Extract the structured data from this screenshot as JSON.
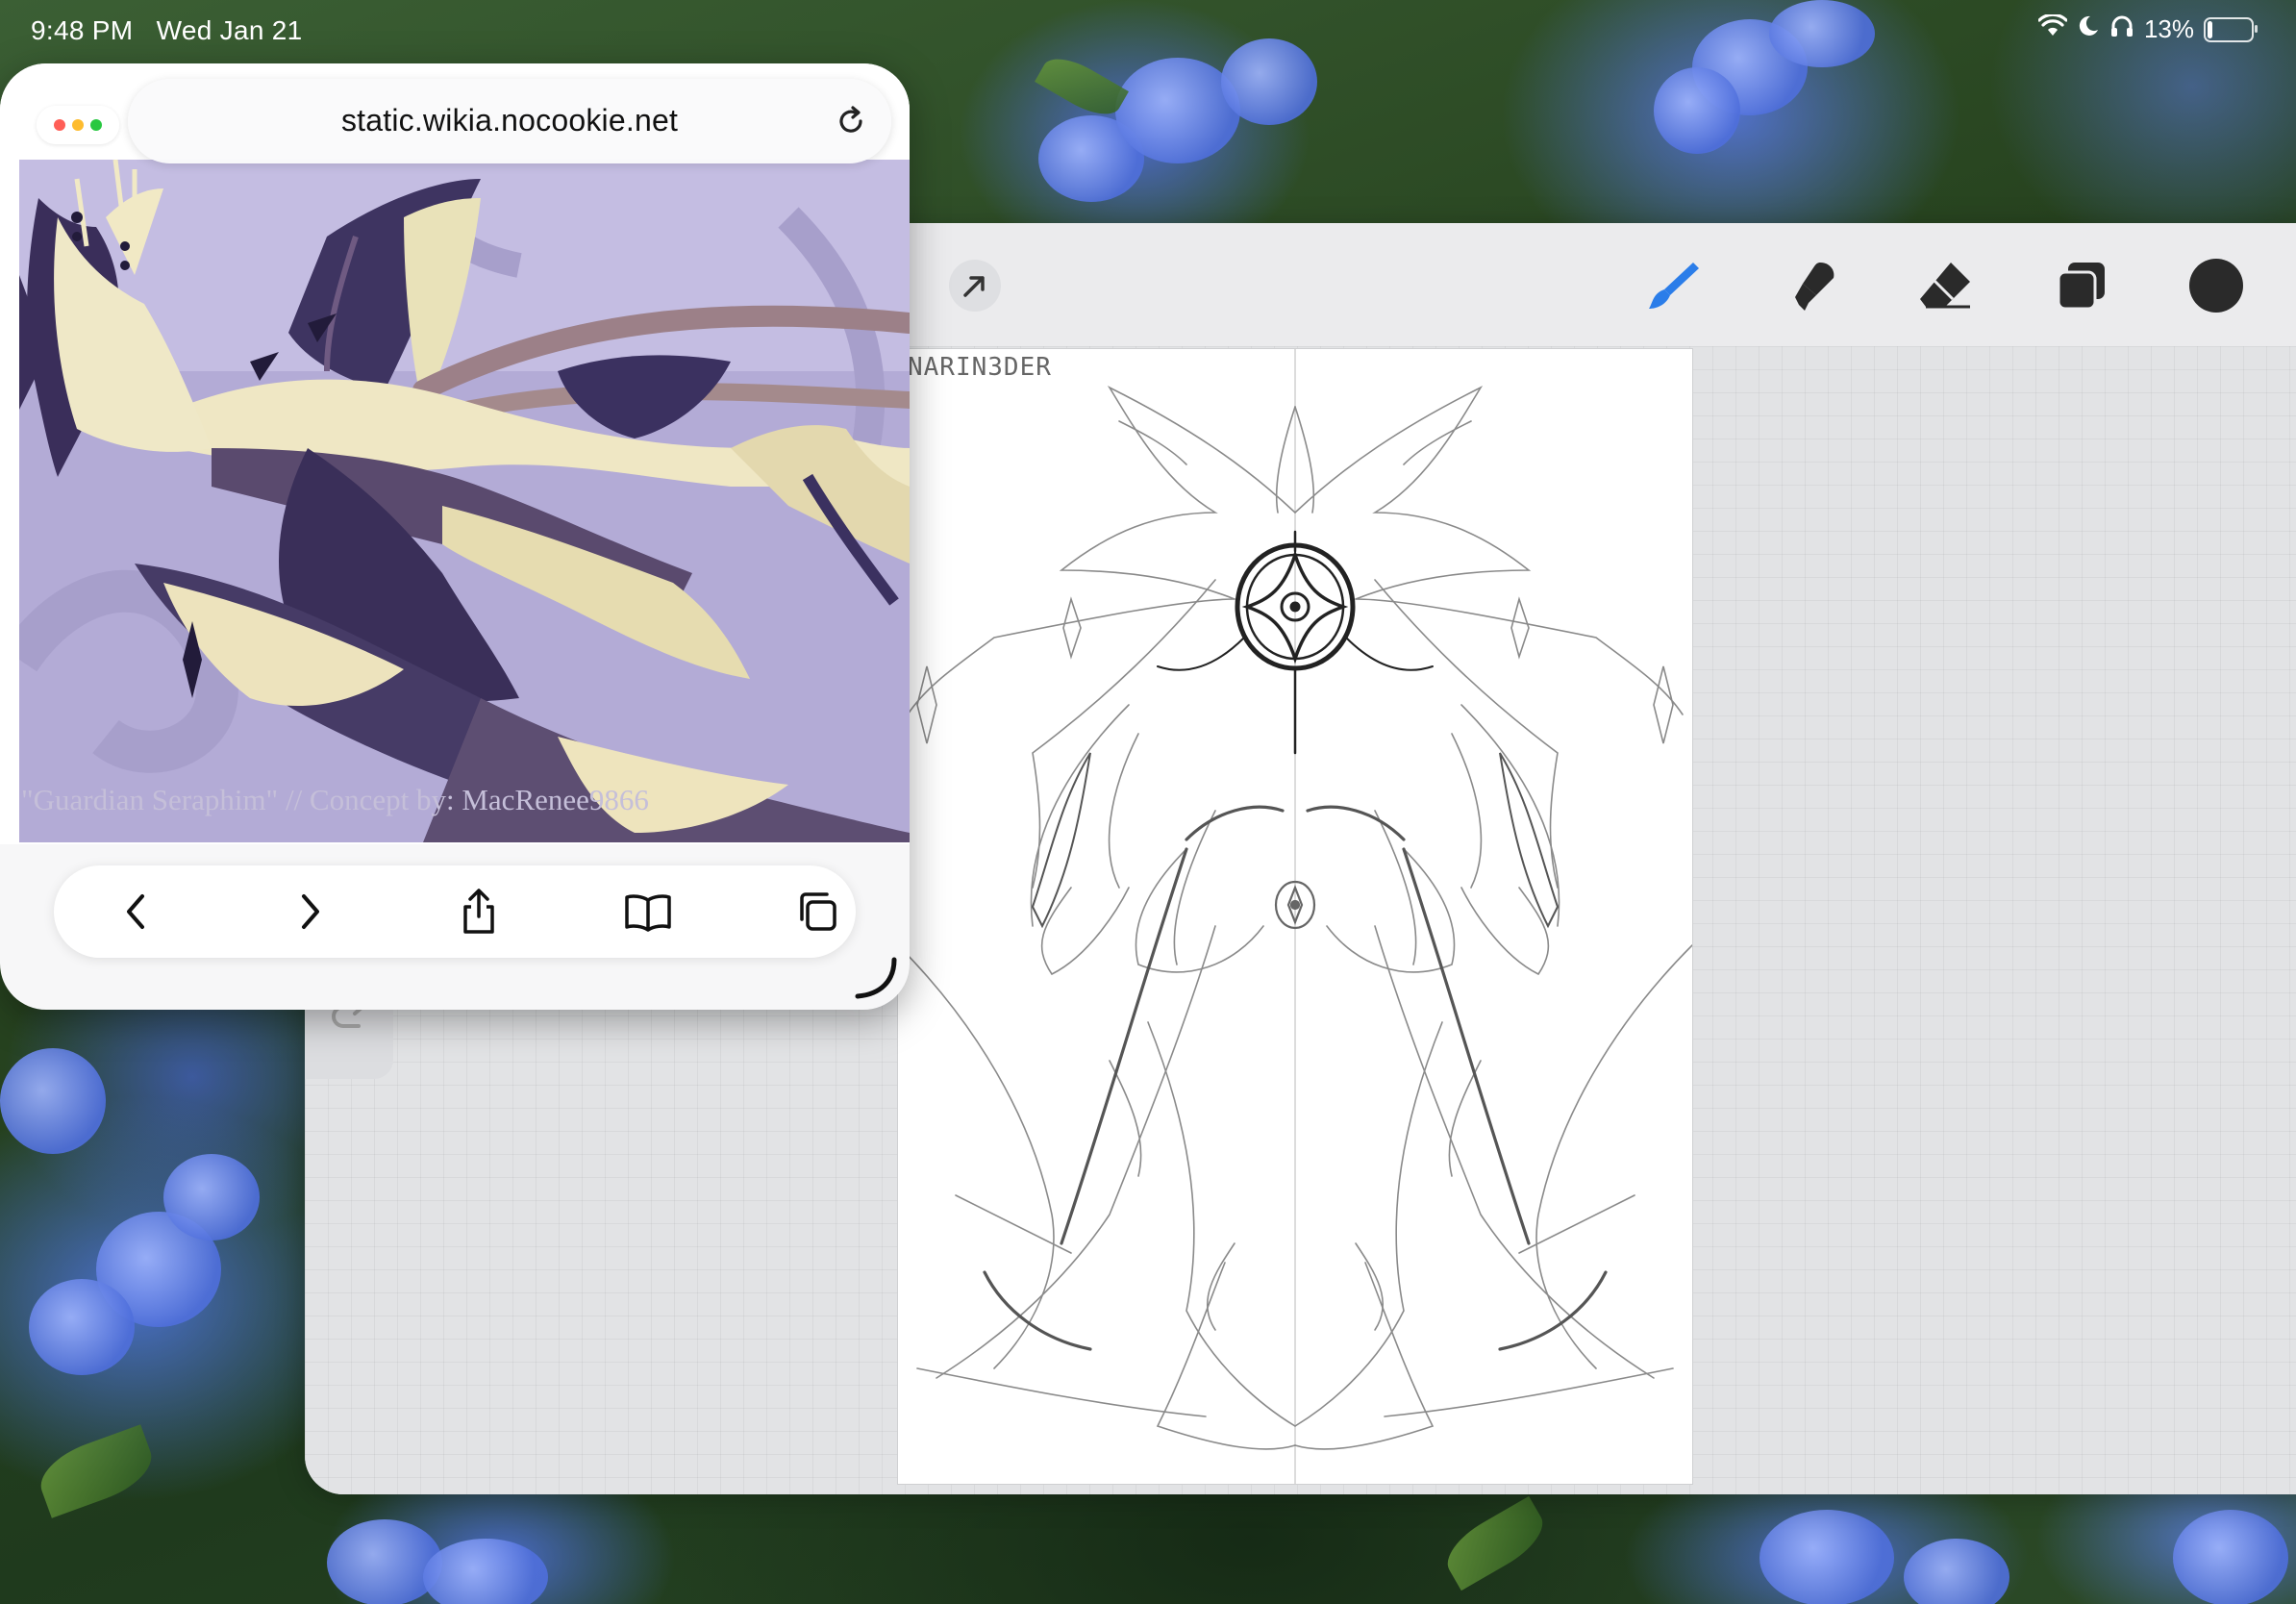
{
  "status_bar": {
    "time": "9:48 PM",
    "date": "Wed Jan 21",
    "battery": "13%",
    "battery_level": 0.13,
    "icons": [
      "wifi-icon",
      "moon-icon",
      "headphones-icon",
      "battery-icon"
    ]
  },
  "safari": {
    "url": "static.wikia.nocookie.net",
    "window_dot_colors": [
      "#ff5f57",
      "#febc2e",
      "#28c840"
    ],
    "image_caption": "\"Guardian Seraphim\" // Concept by: MacRenee9866",
    "toolbar_icons": [
      "back-icon",
      "forward-icon",
      "share-icon",
      "bookmarks-icon",
      "tabs-icon"
    ]
  },
  "procreate": {
    "tools": [
      "brush-icon",
      "smudge-icon",
      "eraser-icon",
      "layers-icon",
      "color-icon"
    ],
    "accent_color": "#2b7de9",
    "current_color": "#2a2a2a",
    "canvas_watermark": "NARIN3DER"
  }
}
